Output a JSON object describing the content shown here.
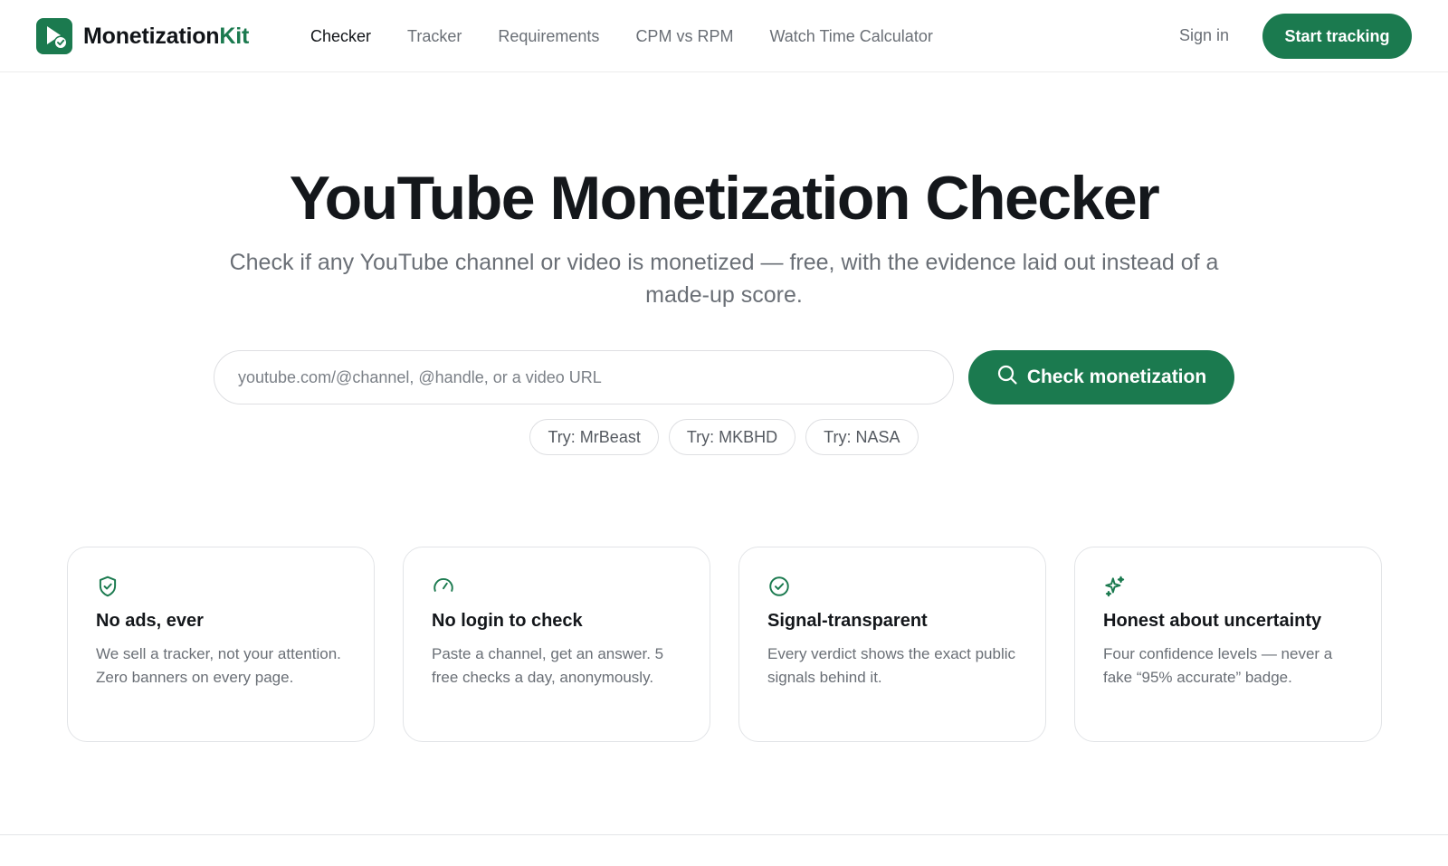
{
  "brand": {
    "name_main": "Monetization",
    "name_accent": "Kit",
    "accent_color": "#1b7a4f",
    "logo_icon": "play-check-icon"
  },
  "nav": {
    "items": [
      {
        "label": "Checker",
        "active": true
      },
      {
        "label": "Tracker",
        "active": false
      },
      {
        "label": "Requirements",
        "active": false
      },
      {
        "label": "CPM vs RPM",
        "active": false
      },
      {
        "label": "Watch Time Calculator",
        "active": false
      }
    ],
    "signin_label": "Sign in",
    "cta_label": "Start tracking"
  },
  "hero": {
    "title": "YouTube Monetization Checker",
    "subtitle": "Check if any YouTube channel or video is monetized — free, with the evidence laid out instead of a made-up score."
  },
  "search": {
    "placeholder": "youtube.com/@channel, @handle, or a video URL",
    "value": "",
    "button_label": "Check monetization",
    "button_icon": "search-icon"
  },
  "suggestions": [
    {
      "label": "Try: MrBeast"
    },
    {
      "label": "Try: MKBHD"
    },
    {
      "label": "Try: NASA"
    }
  ],
  "features": [
    {
      "icon": "shield-check-icon",
      "title": "No ads, ever",
      "description": "We sell a tracker, not your attention. Zero banners on every page."
    },
    {
      "icon": "speedometer-icon",
      "title": "No login to check",
      "description": "Paste a channel, get an answer. 5 free checks a day, anonymously."
    },
    {
      "icon": "check-circle-icon",
      "title": "Signal-transparent",
      "description": "Every verdict shows the exact public signals behind it."
    },
    {
      "icon": "sparkles-icon",
      "title": "Honest about uncertainty",
      "description": "Four confidence levels — never a fake “95% accurate” badge."
    }
  ]
}
